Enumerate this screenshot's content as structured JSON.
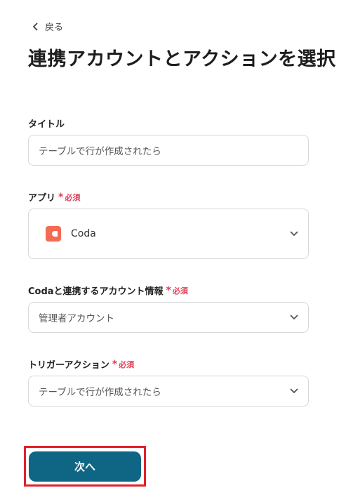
{
  "nav": {
    "back_label": "戻る"
  },
  "page": {
    "title": "連携アカウントとアクションを選択"
  },
  "required_label": "必須",
  "fields": {
    "title": {
      "label": "タイトル",
      "value": "テーブルで行が作成されたら"
    },
    "app": {
      "label": "アプリ",
      "value": "Coda",
      "icon": "coda-logo"
    },
    "account": {
      "label": "Codaと連携するアカウント情報",
      "value": "管理者アカウント"
    },
    "trigger": {
      "label": "トリガーアクション",
      "value": "テーブルで行が作成されたら"
    }
  },
  "buttons": {
    "next_label": "次へ"
  },
  "colors": {
    "primary": "#0e6684",
    "required": "#e0405a",
    "highlight_outline": "#e0202a",
    "coda_brand": "#f46a54"
  }
}
